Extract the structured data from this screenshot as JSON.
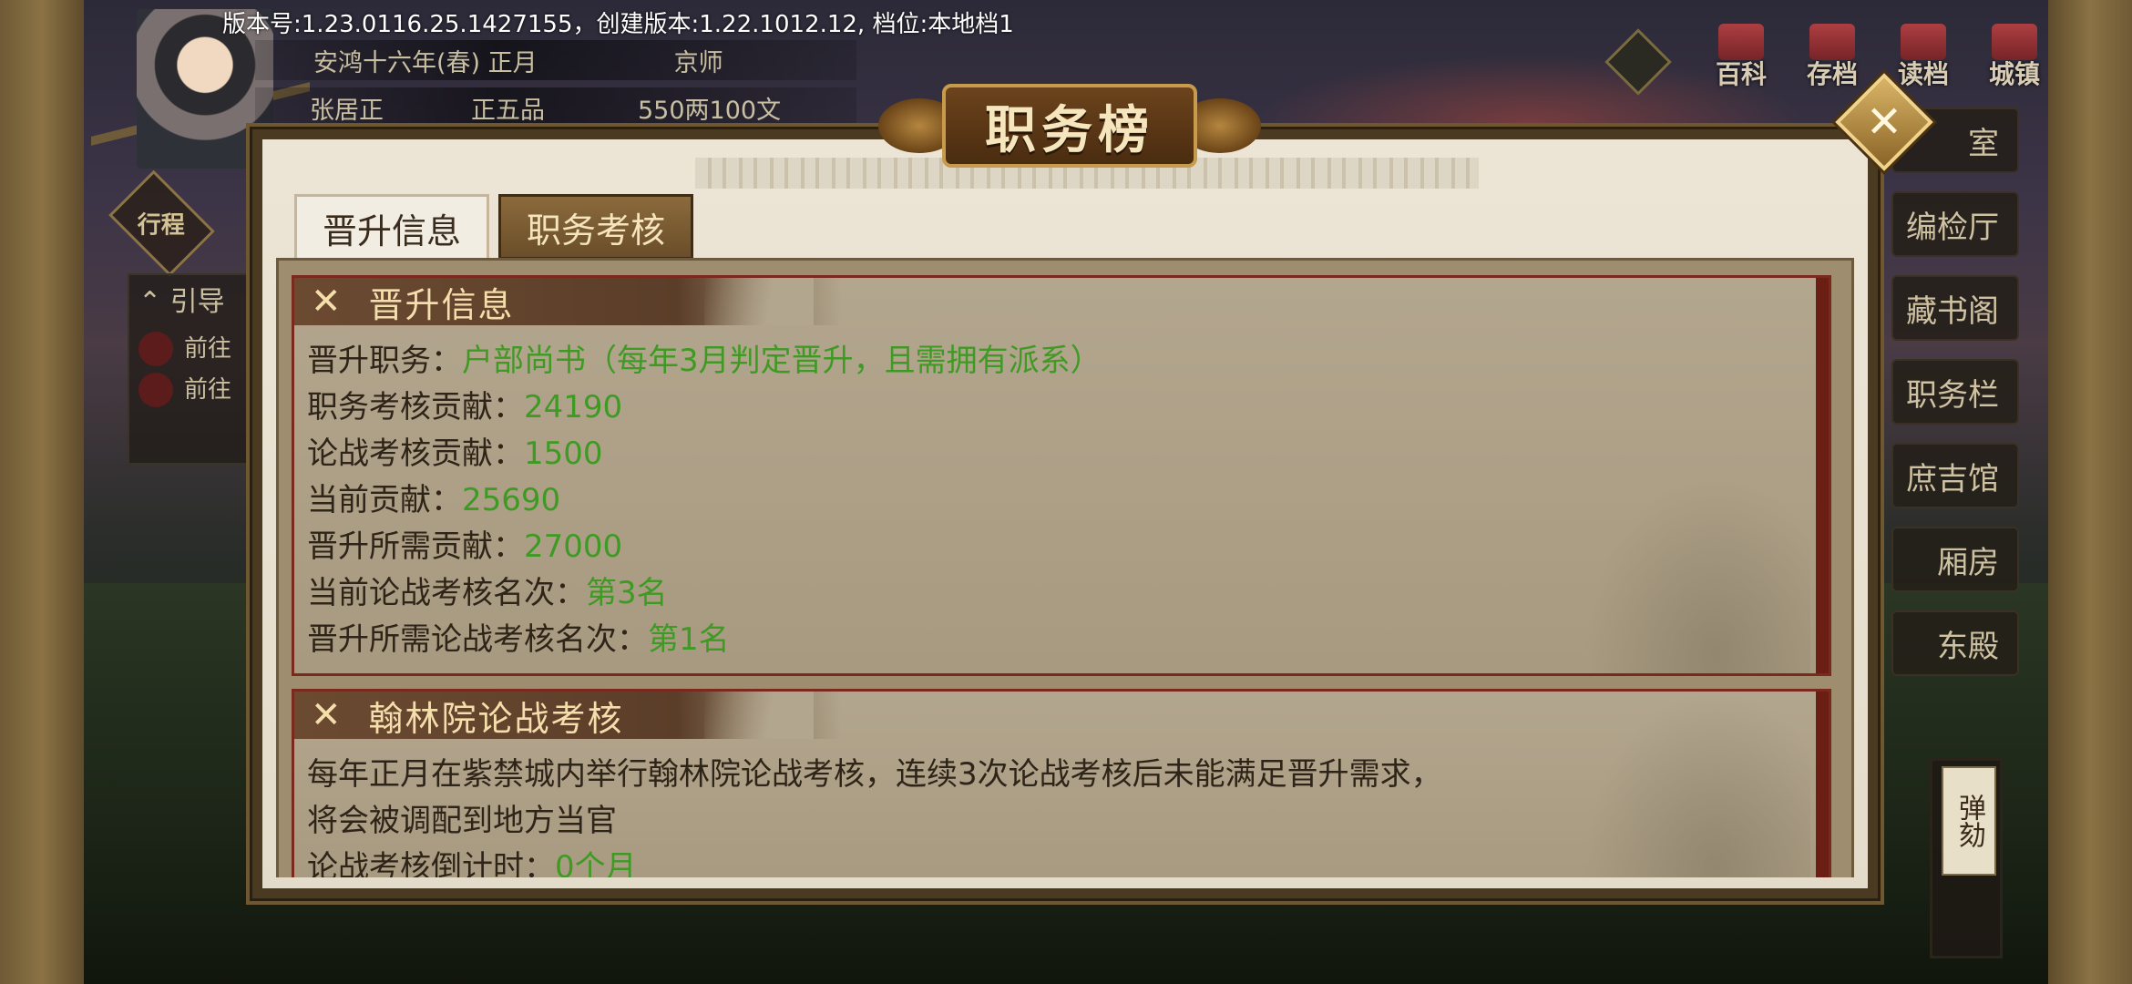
{
  "version_line": "版本号:1.23.0116.25.1427155，创建版本:1.22.1012.12, 档位:本地档1",
  "player": {
    "date": "安鸿十六年(春) 正月",
    "location": "京师",
    "name": "张居正",
    "rank": "正五品",
    "money": "550两100文"
  },
  "left_menu": {
    "travel_button": "行程",
    "guide_title": "引导",
    "guide_items": [
      "前往",
      "前往"
    ]
  },
  "top_icons": [
    "百科",
    "存档",
    "读档",
    "城镇"
  ],
  "side_menu": [
    "室",
    "编检厅",
    "藏书阁",
    "职务栏",
    "庶吉馆",
    "厢房",
    "东殿"
  ],
  "impeach_button": "弹劾",
  "dialog": {
    "title": "职务榜",
    "close_icon": "✕",
    "tabs": [
      {
        "label": "晋升信息",
        "active": true
      },
      {
        "label": "职务考核",
        "active": false
      }
    ],
    "card1": {
      "title": "晋升信息",
      "rows": [
        {
          "label": "晋升职务：",
          "value": "户部尚书（每年3月判定晋升，且需拥有派系）"
        },
        {
          "label": "职务考核贡献：",
          "value": "24190"
        },
        {
          "label": "论战考核贡献：",
          "value": "1500"
        },
        {
          "label": "当前贡献：",
          "value": "25690"
        },
        {
          "label": "晋升所需贡献：",
          "value": "27000"
        },
        {
          "label": "当前论战考核名次：",
          "value": "第3名"
        },
        {
          "label": "晋升所需论战考核名次：",
          "value": "第1名"
        }
      ]
    },
    "card2": {
      "title": "翰林院论战考核",
      "line1": "每年正月在紫禁城内举行翰林院论战考核，连续3次论战考核后未能满足晋升需求，",
      "line2": "将会被调配到地方当官",
      "countdown_label": "论战考核倒计时：",
      "countdown_value": "0个月"
    }
  }
}
